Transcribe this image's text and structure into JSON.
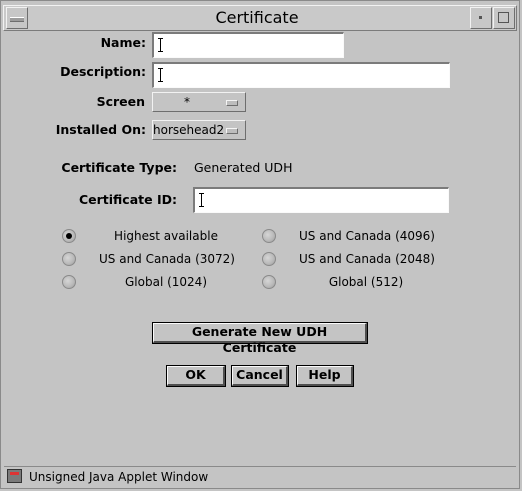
{
  "window": {
    "title": "Certificate"
  },
  "form": {
    "name_label": "Name:",
    "description_label": "Description:",
    "screen_label": "Screen",
    "screen_value": "*",
    "installed_on_label": "Installed On:",
    "installed_on_value": "horsehead2",
    "cert_type_label": "Certificate Type:",
    "cert_type_value": "Generated UDH",
    "cert_id_label": "Certificate ID:",
    "name_value": "",
    "description_value": "",
    "cert_id_value": ""
  },
  "options": [
    {
      "label": "Highest available",
      "selected": true
    },
    {
      "label": "US and Canada (4096)",
      "selected": false
    },
    {
      "label": "US and Canada (3072)",
      "selected": false
    },
    {
      "label": "US and Canada (2048)",
      "selected": false
    },
    {
      "label": "Global (1024)",
      "selected": false
    },
    {
      "label": "Global (512)",
      "selected": false
    }
  ],
  "buttons": {
    "generate": "Generate New UDH Certificate",
    "ok": "OK",
    "cancel": "Cancel",
    "help": "Help"
  },
  "status": {
    "text": "Unsigned Java Applet Window"
  }
}
